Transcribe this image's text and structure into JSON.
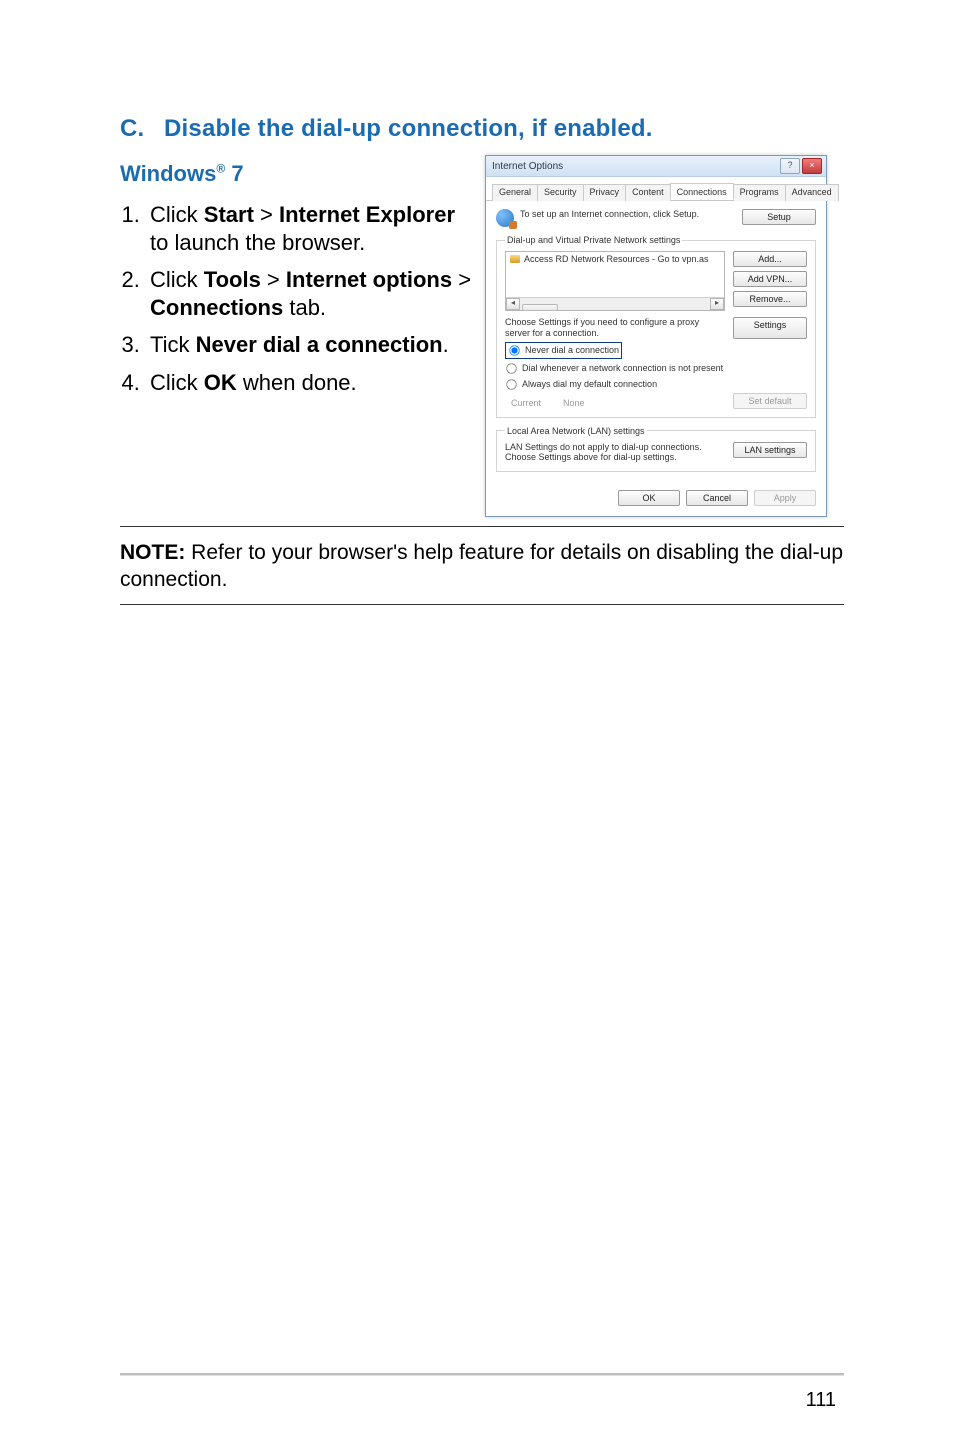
{
  "heading": {
    "letter": "C.",
    "text": "Disable the dial-up connection, if enabled."
  },
  "subheading": {
    "prefix": "Windows",
    "reg": "®",
    "suffix": " 7"
  },
  "steps": {
    "s1a": "Click ",
    "s1b": "Start",
    "s1c": " > ",
    "s1d": "Internet Explorer",
    "s1e": " to launch the browser.",
    "s2a": "Click ",
    "s2b": "Tools",
    "s2c": " > ",
    "s2d": "Internet options",
    "s2e": " > ",
    "s2f": "Connections",
    "s2g": " tab.",
    "s3a": "Tick ",
    "s3b": "Never dial a connection",
    "s3c": ".",
    "s4a": "Click ",
    "s4b": "OK",
    "s4c": " when done."
  },
  "dialog": {
    "title": "Internet Options",
    "help_symbol": "?",
    "close_symbol": "×",
    "tabs": {
      "general": "General",
      "security": "Security",
      "privacy": "Privacy",
      "content": "Content",
      "connections": "Connections",
      "programs": "Programs",
      "advanced": "Advanced"
    },
    "setup_text": "To set up an Internet connection, click Setup.",
    "setup_btn": "Setup",
    "group_dial": "Dial-up and Virtual Private Network settings",
    "list_item": "Access RD Network Resources - Go to vpn.as",
    "scroll_left": "◂",
    "scroll_right": "▸",
    "add_btn": "Add...",
    "add_vpn_btn": "Add VPN...",
    "remove_btn": "Remove...",
    "proxy_note": "Choose Settings if you need to configure a proxy server for a connection.",
    "settings_btn": "Settings",
    "radio_never": "Never dial a connection",
    "radio_whenever": "Dial whenever a network connection is not present",
    "radio_always": "Always dial my default connection",
    "current_label": "Current",
    "current_value": "None",
    "set_default_btn": "Set default",
    "group_lan": "Local Area Network (LAN) settings",
    "lan_text": "LAN Settings do not apply to dial-up connections. Choose Settings above for dial-up settings.",
    "lan_btn": "LAN settings",
    "ok": "OK",
    "cancel": "Cancel",
    "apply": "Apply"
  },
  "note": {
    "label": "NOTE:",
    "text": " Refer to your browser's help feature for details on disabling the dial-up connection."
  },
  "page_number": "111"
}
